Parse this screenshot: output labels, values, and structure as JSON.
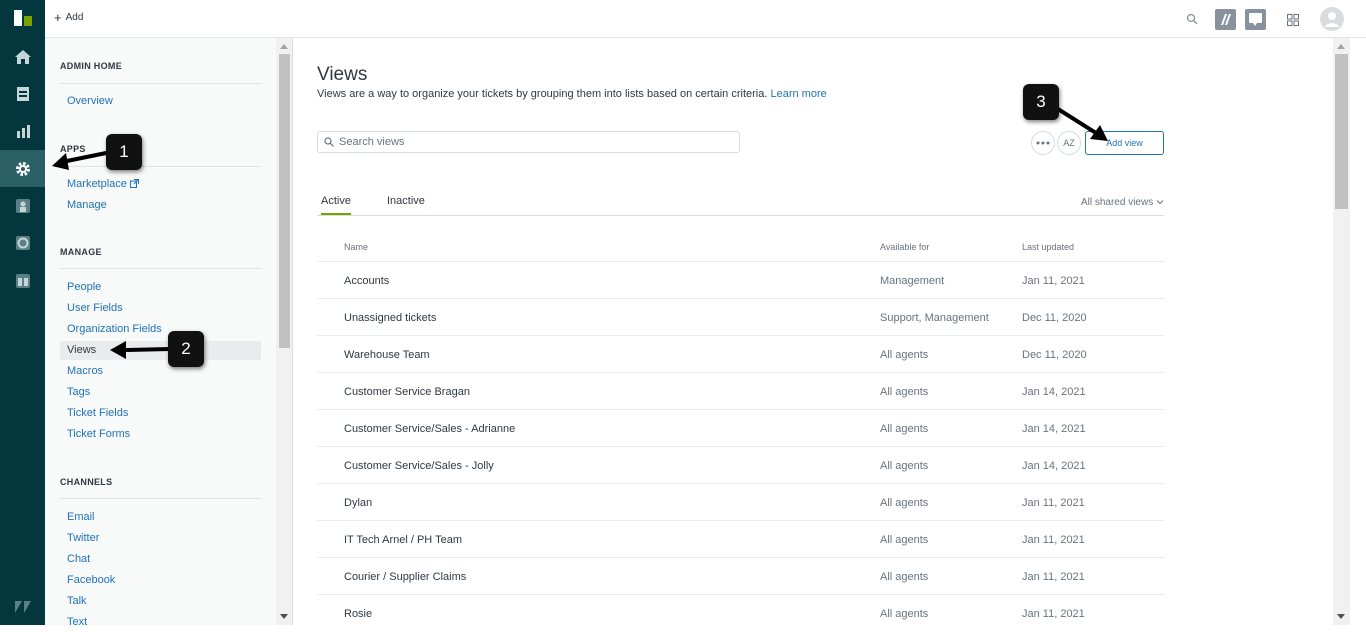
{
  "topbar": {
    "add_label": "Add"
  },
  "sidebar": {
    "sections": {
      "admin_home": {
        "title": "ADMIN HOME",
        "items": [
          "Overview"
        ]
      },
      "apps": {
        "title": "APPS",
        "items": [
          "Marketplace",
          "Manage"
        ]
      },
      "manage": {
        "title": "MANAGE",
        "items": [
          "People",
          "User Fields",
          "Organization Fields",
          "Views",
          "Macros",
          "Tags",
          "Ticket Fields",
          "Ticket Forms"
        ]
      },
      "channels": {
        "title": "CHANNELS",
        "items": [
          "Email",
          "Twitter",
          "Chat",
          "Facebook",
          "Talk",
          "Text"
        ]
      }
    },
    "selected": "Views"
  },
  "main": {
    "title": "Views",
    "subtitle": "Views are a way to organize your tickets by grouping them into lists based on certain criteria.",
    "learn_more": "Learn more",
    "search_placeholder": "Search views",
    "sort_label": "AZ",
    "add_view_label": "Add view",
    "tabs": [
      "Active",
      "Inactive"
    ],
    "filter_label": "All shared views",
    "columns": [
      "Name",
      "Available for",
      "Last updated"
    ],
    "rows": [
      {
        "name": "Accounts",
        "available": "Management",
        "updated": "Jan 11, 2021"
      },
      {
        "name": "Unassigned tickets",
        "available": "Support, Management",
        "updated": "Dec 11, 2020"
      },
      {
        "name": "Warehouse Team",
        "available": "All agents",
        "updated": "Dec 11, 2020"
      },
      {
        "name": "Customer Service Bragan",
        "available": "All agents",
        "updated": "Jan 14, 2021"
      },
      {
        "name": "Customer Service/Sales - Adrianne",
        "available": "All agents",
        "updated": "Jan 14, 2021"
      },
      {
        "name": "Customer Service/Sales - Jolly",
        "available": "All agents",
        "updated": "Jan 14, 2021"
      },
      {
        "name": "Dylan",
        "available": "All agents",
        "updated": "Jan 11, 2021"
      },
      {
        "name": "IT Tech Arnel / PH Team",
        "available": "All agents",
        "updated": "Jan 11, 2021"
      },
      {
        "name": "Courier / Supplier Claims",
        "available": "All agents",
        "updated": "Jan 11, 2021"
      },
      {
        "name": "Rosie",
        "available": "All agents",
        "updated": "Jan 11, 2021"
      }
    ]
  },
  "callouts": [
    "1",
    "2",
    "3"
  ],
  "colors": {
    "rail": "#03363d",
    "link": "#1f73b7",
    "active_tab": "#78a300"
  }
}
